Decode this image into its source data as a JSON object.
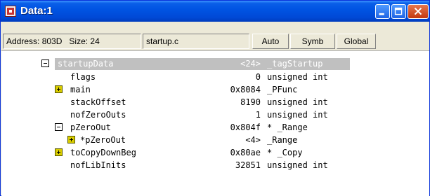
{
  "window": {
    "title": "Data:1"
  },
  "infobar": {
    "address": "Address: 803D",
    "size": "Size: 24",
    "file": "startup.c",
    "auto": "Auto",
    "symb": "Symb",
    "global": "Global"
  },
  "rows": [
    {
      "name": "startupData",
      "value": "<24>",
      "type": "_tagStartup",
      "expander": "minus",
      "selected": true
    },
    {
      "name": "flags",
      "value": "0",
      "type": "unsigned int",
      "expander": "none"
    },
    {
      "name": "main",
      "value": "0x8084",
      "type": "_PFunc",
      "expander": "plus"
    },
    {
      "name": "stackOffset",
      "value": "8190",
      "type": "unsigned int",
      "expander": "none"
    },
    {
      "name": "nofZeroOuts",
      "value": "1",
      "type": "unsigned int",
      "expander": "none"
    },
    {
      "name": "pZeroOut",
      "value": "0x804f",
      "type": "* _Range",
      "expander": "minus"
    },
    {
      "name": "*pZeroOut",
      "value": "<4>",
      "type": "_Range",
      "expander": "plus"
    },
    {
      "name": "toCopyDownBeg",
      "value": "0x80ae",
      "type": "* _Copy",
      "expander": "plus"
    },
    {
      "name": "nofLibInits",
      "value": "32851",
      "type": "unsigned int",
      "expander": "none"
    }
  ]
}
